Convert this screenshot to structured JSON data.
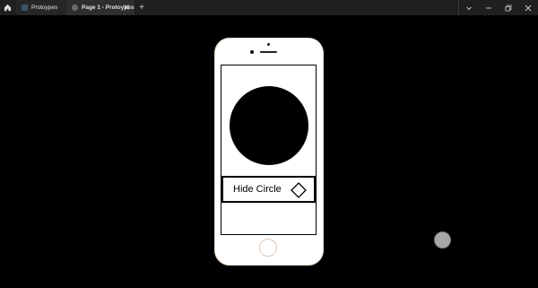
{
  "tabs": [
    {
      "label": "Protoypes"
    },
    {
      "label": "Page 1 - Protoypes"
    }
  ],
  "icons": {
    "home": "home-icon",
    "new_tab": "+",
    "close": "close-icon",
    "chevron": "chevron-down-icon",
    "minimize": "minimize-icon",
    "restore": "restore-icon",
    "window_close": "close-icon"
  },
  "prototype": {
    "button_label": "Hide Circle",
    "circle_color": "#000000",
    "screen_border": "#000000"
  },
  "colors": {
    "canvas": "#000000",
    "titlebar": "#1f1f1f",
    "active_tab": "#2e2e2e",
    "phone_body": "#ffffff"
  }
}
